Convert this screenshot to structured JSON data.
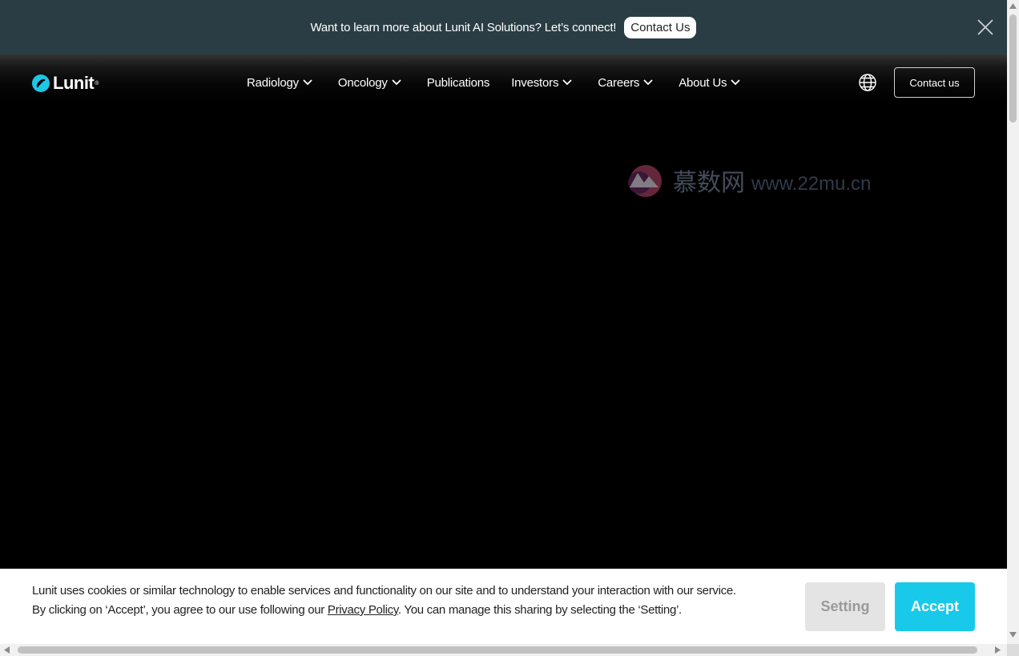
{
  "promo": {
    "text": "Want to learn more about Lunit AI Solutions? Let’s connect!",
    "contact_label": "Contact Us",
    "close_icon": "close-icon",
    "background": "#2a3d44"
  },
  "logo": {
    "text": "Lunit",
    "reg": "®",
    "accent": "#1ec6e6"
  },
  "nav": {
    "items": [
      {
        "label": "Radiology",
        "has_dropdown": true
      },
      {
        "label": "Oncology",
        "has_dropdown": true
      },
      {
        "label": "Publications",
        "has_dropdown": false
      },
      {
        "label": "Investors",
        "has_dropdown": true
      },
      {
        "label": "Careers",
        "has_dropdown": true
      },
      {
        "label": "About Us",
        "has_dropdown": true
      }
    ],
    "globe_icon": "globe-icon",
    "contact_label": "Contact us"
  },
  "watermark": {
    "cn": "慕数网",
    "url": "www.22mu.cn"
  },
  "cookie": {
    "line1": "Lunit uses cookies or similar technology to enable services and functionality on our site and to understand your interaction with our service.",
    "line2_before": "By clicking on ‘Accept’, you agree to our use following our ",
    "privacy_link": "Privacy Policy",
    "line2_after": ". You can manage this sharing by selecting the ‘Setting’.",
    "setting_label": "Setting",
    "accept_label": "Accept",
    "accept_color": "#19c9ea"
  }
}
